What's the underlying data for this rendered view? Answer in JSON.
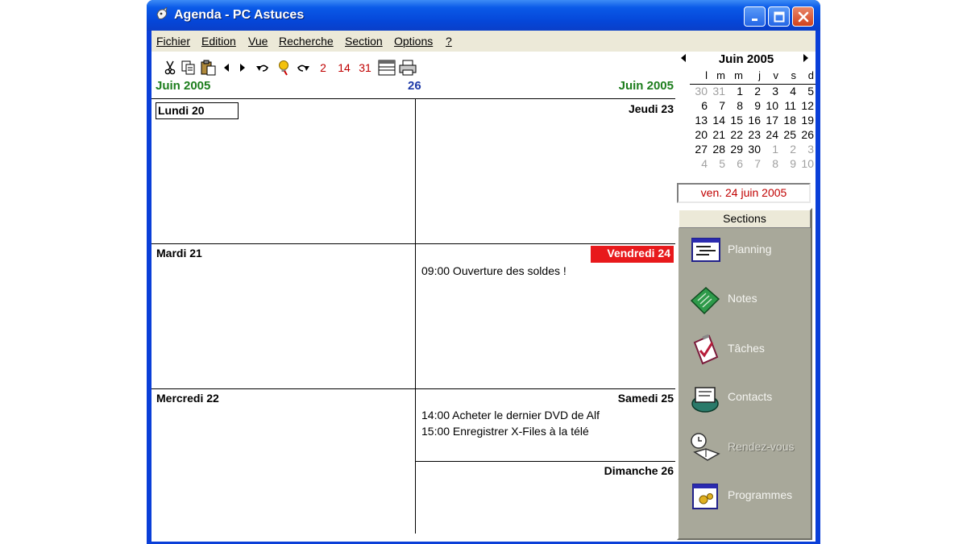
{
  "window": {
    "title": "Agenda - PC Astuces"
  },
  "menu": [
    "Fichier",
    "Edition",
    "Vue",
    "Recherche",
    "Section",
    "Options",
    "?"
  ],
  "toolbar": {
    "icons": [
      "cut-icon",
      "copy-icon",
      "paste-icon",
      "prev-icon",
      "next-icon",
      "undo-icon",
      "lightbulb-icon",
      "redo-icon"
    ],
    "views": [
      "2",
      "14",
      "31"
    ]
  },
  "header": {
    "left_month": "Juin 2005",
    "week_number": "26",
    "right_month": "Juin 2005"
  },
  "days": [
    {
      "name": "Lundi 20",
      "events": []
    },
    {
      "name": "Mardi 21",
      "events": []
    },
    {
      "name": "Mercredi 22",
      "events": []
    },
    {
      "name": "Jeudi 23",
      "events": []
    },
    {
      "name": "Vendredi 24",
      "events": [
        "09:00 Ouverture des soldes !"
      ]
    },
    {
      "name": "Samedi 25",
      "events": [
        "14:00 Acheter le dernier DVD de Alf",
        "15:00 Enregistrer X-Files à la télé"
      ]
    },
    {
      "name": "Dimanche 26",
      "events": []
    }
  ],
  "calendar": {
    "title": "Juin 2005",
    "weekdays": [
      "l",
      "m",
      "m",
      "j",
      "v",
      "s",
      "d"
    ],
    "weeks": [
      [
        "30",
        "31",
        "1",
        "2",
        "3",
        "4",
        "5"
      ],
      [
        "6",
        "7",
        "8",
        "9",
        "10",
        "11",
        "12"
      ],
      [
        "13",
        "14",
        "15",
        "16",
        "17",
        "18",
        "19"
      ],
      [
        "20",
        "21",
        "22",
        "23",
        "24",
        "25",
        "26"
      ],
      [
        "27",
        "28",
        "29",
        "30",
        "1",
        "2",
        "3"
      ],
      [
        "4",
        "5",
        "6",
        "7",
        "8",
        "9",
        "10"
      ]
    ],
    "selected_date": "ven. 24 juin 2005"
  },
  "sections": {
    "title": "Sections",
    "items": [
      {
        "label": "Planning",
        "icon": "planning-icon"
      },
      {
        "label": "Notes",
        "icon": "notes-icon"
      },
      {
        "label": "Tâches",
        "icon": "tasks-icon"
      },
      {
        "label": "Contacts",
        "icon": "contacts-icon"
      },
      {
        "label": "Rendez-vous",
        "icon": "appointments-icon"
      },
      {
        "label": "Programmes",
        "icon": "programs-icon"
      }
    ]
  },
  "colors": {
    "title_bar": "#0546d8",
    "today_highlight": "#e8191c",
    "month_header": "#1c7d1c",
    "week_number": "#1e3aa8",
    "sections_panel": "#a8a89a"
  }
}
